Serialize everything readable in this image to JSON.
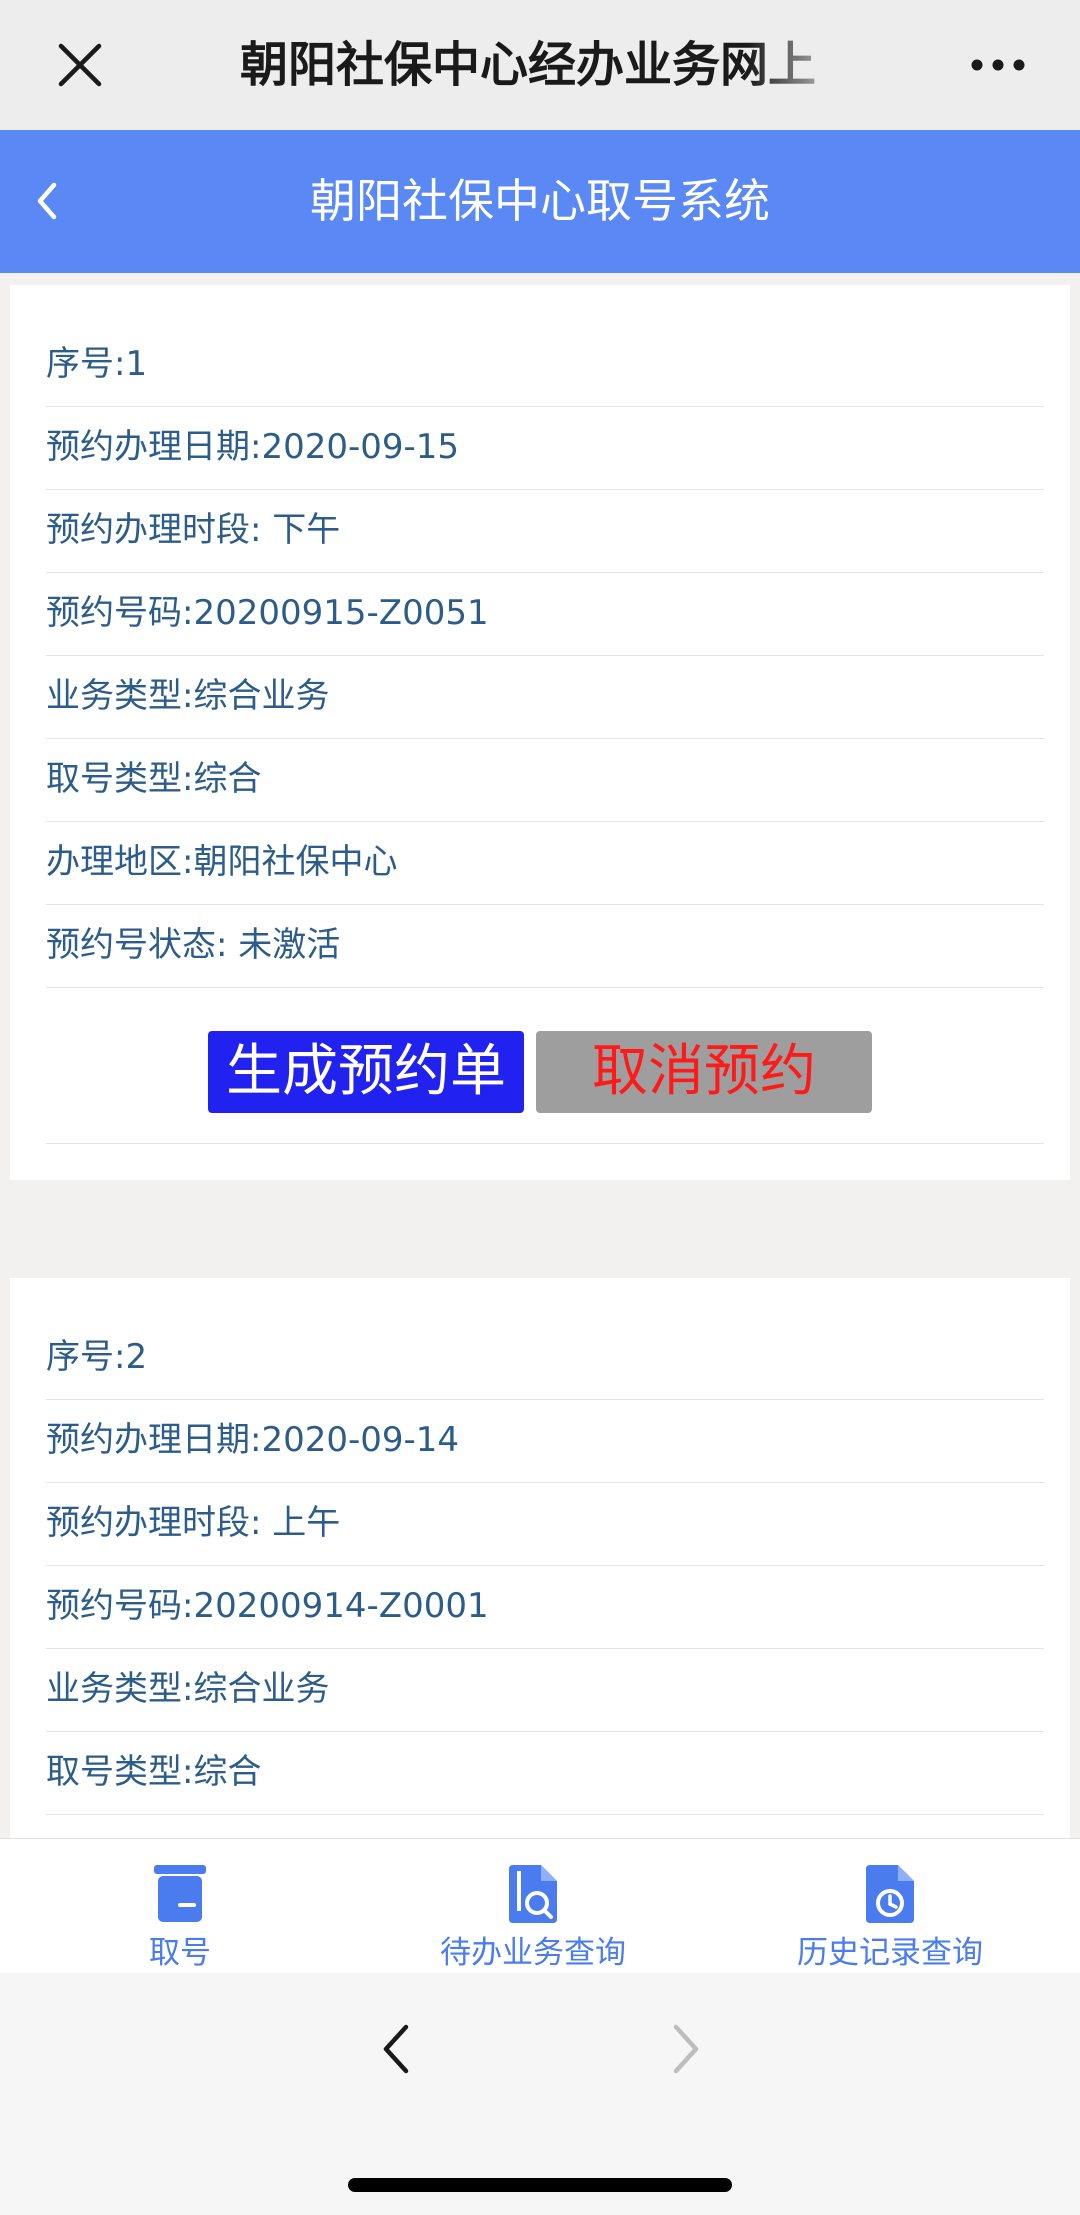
{
  "wechat": {
    "title": "朝阳社保中心经办业务网上",
    "close_icon": "close-icon",
    "more_icon": "more-dots-icon"
  },
  "header": {
    "title": "朝阳社保中心取号系统",
    "back_icon": "chevron-left-icon"
  },
  "cards": [
    {
      "rows": [
        {
          "label": "序号:",
          "value": "1"
        },
        {
          "label": "预约办理日期:",
          "value": "2020-09-15"
        },
        {
          "label": "预约办理时段:",
          "value": " 下午"
        },
        {
          "label": "预约号码:",
          "value": "20200915-Z0051"
        },
        {
          "label": "业务类型:",
          "value": "综合业务"
        },
        {
          "label": "取号类型:",
          "value": "综合"
        },
        {
          "label": "办理地区:",
          "value": "朝阳社保中心"
        },
        {
          "label": "预约号状态:",
          "value": " 未激活"
        }
      ],
      "generate_label": "生成预约单",
      "cancel_label": "取消预约"
    },
    {
      "rows": [
        {
          "label": "序号:",
          "value": "2"
        },
        {
          "label": "预约办理日期:",
          "value": "2020-09-14"
        },
        {
          "label": "预约办理时段:",
          "value": " 上午"
        },
        {
          "label": "预约号码:",
          "value": "20200914-Z0001"
        },
        {
          "label": "业务类型:",
          "value": "综合业务"
        },
        {
          "label": "取号类型:",
          "value": "综合"
        }
      ]
    }
  ],
  "tabs": [
    {
      "label": "取号",
      "icon": "ticket-icon"
    },
    {
      "label": "待办业务查询",
      "icon": "document-search-icon"
    },
    {
      "label": "历史记录查询",
      "icon": "document-clock-icon"
    }
  ],
  "colors": {
    "header_bg": "#5a88f4",
    "accent": "#4a7cf0",
    "generate_btn": "#2121f0",
    "cancel_btn": "#9e9e9e",
    "cancel_text": "#ff1a1a",
    "row_text": "#2c5d8a"
  }
}
